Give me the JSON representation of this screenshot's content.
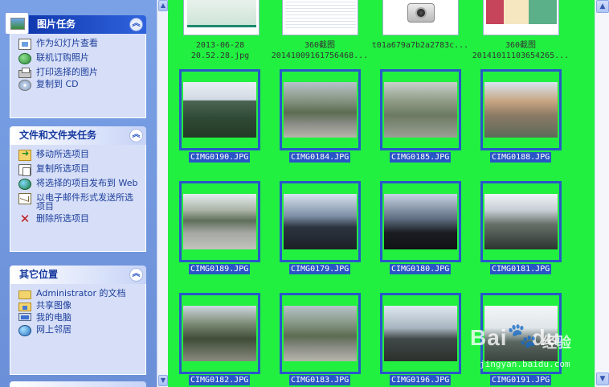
{
  "task_pane": {
    "picture_tasks": {
      "title": "图片任务",
      "items": [
        {
          "label": "作为幻灯片查看",
          "icon": "slideshow-icon"
        },
        {
          "label": "联机订购照片",
          "icon": "order-prints-icon"
        },
        {
          "label": "打印选择的图片",
          "icon": "printer-icon"
        },
        {
          "label": "复制到 CD",
          "icon": "cd-icon"
        }
      ]
    },
    "file_tasks": {
      "title": "文件和文件夹任务",
      "items": [
        {
          "label": "移动所选项目",
          "icon": "move-icon"
        },
        {
          "label": "复制所选项目",
          "icon": "copy-icon"
        },
        {
          "label": "将选择的项目发布到 Web",
          "icon": "publish-web-icon"
        },
        {
          "label": "以电子邮件形式发送所选项目",
          "icon": "email-icon"
        },
        {
          "label": "删除所选项目",
          "icon": "delete-icon"
        }
      ]
    },
    "other_places": {
      "title": "其它位置",
      "items": [
        {
          "label": "Administrator 的文档",
          "icon": "folder-icon"
        },
        {
          "label": "共享图像",
          "icon": "shared-pictures-icon"
        },
        {
          "label": "我的电脑",
          "icon": "my-computer-icon"
        },
        {
          "label": "网上邻居",
          "icon": "network-places-icon"
        }
      ]
    }
  },
  "top_row": [
    {
      "label_line1": "2013-06-28",
      "label_line2": "20.52.28.jpg"
    },
    {
      "label_line1": "360截图",
      "label_line2": "20141009161756468..."
    },
    {
      "label_line1": "t01a679a7b2a2783c...",
      "label_line2": ""
    },
    {
      "label_line1": "360截图",
      "label_line2": "20141011103654265..."
    }
  ],
  "thumbnails": [
    {
      "caption": "CIMG0190.JPG",
      "scene": "mountains"
    },
    {
      "caption": "CIMG0184.JPG",
      "scene": "river"
    },
    {
      "caption": "CIMG0185.JPG",
      "scene": "valley"
    },
    {
      "caption": "CIMG0188.JPG",
      "scene": "town"
    },
    {
      "caption": "CIMG0189.JPG",
      "scene": "shore"
    },
    {
      "caption": "CIMG0179.JPG",
      "scene": "cloudy"
    },
    {
      "caption": "CIMG0180.JPG",
      "scene": "dark-sky"
    },
    {
      "caption": "CIMG0181.JPG",
      "scene": "mist"
    },
    {
      "caption": "CIMG0182.JPG",
      "scene": "rocky-river"
    },
    {
      "caption": "CIMG0183.JPG",
      "scene": "river"
    },
    {
      "caption": "CIMG0196.JPG",
      "scene": "winter-trees"
    },
    {
      "caption": "CIMG0191.JPG",
      "scene": "snowy-peak"
    }
  ],
  "watermark": {
    "logo": "Bai",
    "logo_suffix": "du",
    "cn": "经验",
    "url": "jingyan.baidu.com"
  },
  "colors": {
    "content_bg": "#21f041",
    "selection": "#2956c5",
    "taskpane_bg": "#7aa1e6"
  }
}
